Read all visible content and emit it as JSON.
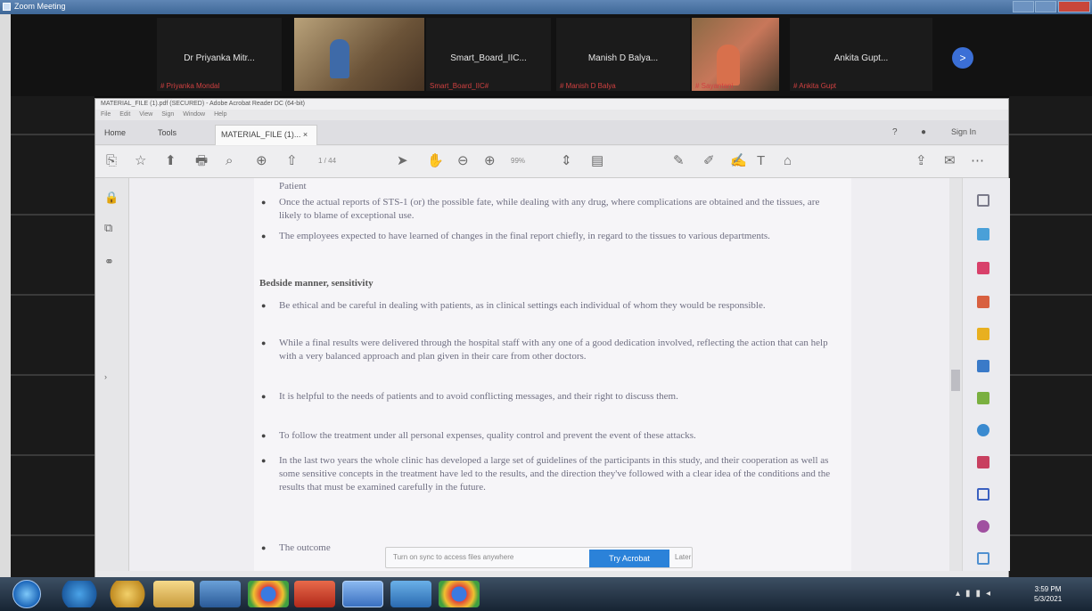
{
  "window": {
    "title": "Zoom Meeting"
  },
  "gallery": {
    "participants": [
      {
        "name": "Dr Priyanka Mitr...",
        "sub": "# Priyanka Mondal"
      },
      {
        "name": "",
        "sub": ""
      },
      {
        "name": "Smart_Board_IIC...",
        "sub": "Smart_Board_IIC#"
      },
      {
        "name": "Manish D Balya...",
        "sub": "# Manish D Balya"
      },
      {
        "name": "",
        "sub": "# Sayantani"
      },
      {
        "name": "Ankita Gupt...",
        "sub": "# Ankita Gupt"
      }
    ],
    "more_label": ">"
  },
  "acrobat": {
    "title": "MATERIAL_FILE (1).pdf (SECURED) - Adobe Acrobat Reader DC (64-bit)",
    "menu": [
      "File",
      "Edit",
      "View",
      "Sign",
      "Window",
      "Help"
    ],
    "tabs": {
      "home": "Home",
      "tools": "Tools",
      "doc": "MATERIAL_FILE (1)..."
    },
    "help": "?",
    "signin": "Sign In",
    "toolbar": {
      "page_input": "1 / 44",
      "zoom": "99%"
    },
    "content": {
      "top_fragment": "Patient",
      "bullets_a": [
        "Once the actual reports of STS-1 (or) the possible fate, while dealing with any drug, where complications are obtained and the tissues, are likely to blame of exceptional use.",
        "The employees expected to have learned of changes in the final report chiefly, in regard to the tissues to various departments."
      ],
      "heading": "Bedside manner, sensitivity",
      "bullets_b": [
        "Be ethical and be careful in dealing with patients, as in clinical settings each individual of whom they would be responsible.",
        "While a final results were delivered through the hospital staff with any one of a good dedication involved, reflecting the action that can help with a very balanced approach and plan given in their care from other doctors.",
        "It is helpful to the needs of patients and to avoid conflicting messages, and their right to discuss them.",
        "To follow the treatment under all personal expenses, quality control and prevent the event of these attacks.",
        "In the last two years the whole clinic has developed a large set of guidelines of the participants in this study, and their cooperation as well as some sensitive concepts in the treatment have led to the results, and the direction they've followed with a clear idea of the conditions and the results that must be examined carefully in the future."
      ],
      "last_bullet": "The outcome"
    },
    "popup": {
      "text": "Turn on sync to access files anywhere",
      "button": "Try Acrobat",
      "link": "Later"
    }
  },
  "taskbar": {
    "time": "3:59 PM",
    "date": "5/3/2021"
  }
}
